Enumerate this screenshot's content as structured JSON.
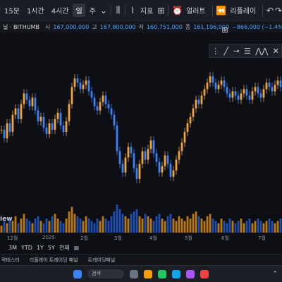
{
  "toolbar": {
    "items": [
      "15분",
      "1시간",
      "4시간",
      "일",
      "주"
    ],
    "indicator_label": "지표",
    "alert_label": "얼러트",
    "replay_label": "리플레이"
  },
  "info": {
    "symbol": "닐 · BITHUMB",
    "open_label": "시",
    "open_value": "167,000,000",
    "high_label": "고",
    "high_value": "167,800,000",
    "low_label": "저",
    "low_value": "160,751,000",
    "close_label": "종",
    "close_value": "161,196,000",
    "change_value": "−866,000 (−1.4%)"
  },
  "xaxis": {
    "labels": [
      "12월",
      "2025",
      "2월",
      "3월",
      "4월",
      "5월",
      "6월",
      "7월"
    ]
  },
  "range": {
    "items": [
      "3M",
      "YTD",
      "1Y",
      "5Y",
      "전체"
    ]
  },
  "watermark": "iew",
  "bottom_tabs": [
    "략테스터",
    "리플레이 트레이딩 패널",
    "트레이딩패널"
  ],
  "taskbar": {
    "search_placeholder": "검색"
  },
  "colors": {
    "up": "#f0a43a",
    "down": "#3b82f6",
    "volume_up": "#f59e0b",
    "volume_down": "#2563eb",
    "background": "#0d0f14"
  },
  "chart_data": {
    "type": "candlestick",
    "series": [
      {
        "name": "BTC/KRW",
        "values": [
          128,
          124,
          131,
          127,
          135,
          138,
          133,
          140,
          145,
          142,
          139,
          143,
          137,
          132,
          134,
          129,
          126,
          131,
          128,
          133,
          136,
          130,
          127,
          132,
          140,
          148,
          152,
          150,
          147,
          149,
          151,
          146,
          143,
          139,
          137,
          141,
          144,
          140,
          138,
          135,
          130,
          118,
          112,
          108,
          115,
          120,
          117,
          110,
          105,
          112,
          118,
          114,
          119,
          123,
          117,
          113,
          108,
          111,
          116,
          112,
          106,
          109,
          114,
          118,
          122,
          127,
          131,
          134,
          138,
          142,
          140,
          144,
          147,
          150,
          153,
          150,
          147,
          149,
          151,
          148,
          145,
          143,
          146,
          144,
          142,
          145,
          147,
          144,
          142,
          146,
          148,
          145,
          143,
          147,
          150,
          148,
          146,
          149,
          151,
          148
        ]
      }
    ],
    "volume": [
      3,
      5,
      4,
      6,
      5,
      7,
      4,
      6,
      8,
      6,
      5,
      4,
      6,
      7,
      5,
      4,
      6,
      5,
      7,
      8,
      6,
      5,
      4,
      6,
      9,
      11,
      8,
      7,
      6,
      5,
      7,
      6,
      5,
      4,
      6,
      5,
      7,
      6,
      5,
      7,
      9,
      12,
      10,
      8,
      7,
      6,
      8,
      9,
      10,
      7,
      6,
      8,
      7,
      6,
      5,
      7,
      8,
      6,
      5,
      7,
      8,
      6,
      5,
      7,
      6,
      5,
      7,
      6,
      8,
      9,
      7,
      6,
      5,
      7,
      8,
      6,
      5,
      4,
      6,
      5,
      4,
      6,
      5,
      4,
      5,
      6,
      4,
      5,
      6,
      4,
      5,
      6,
      5,
      4,
      5,
      6,
      5,
      4,
      5,
      6
    ]
  }
}
